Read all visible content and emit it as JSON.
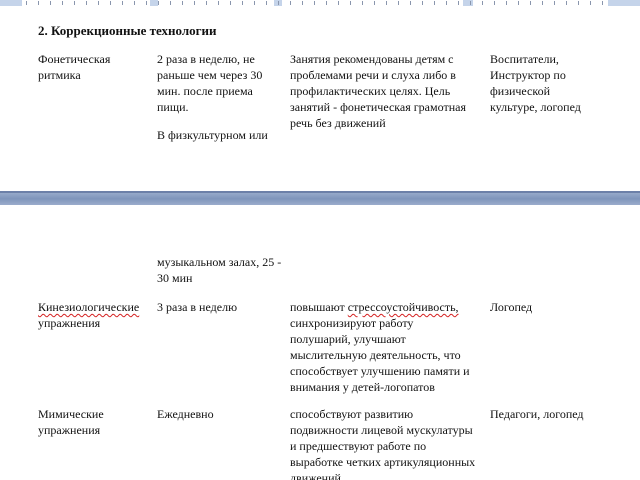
{
  "section": {
    "heading": "2. Коррекционные технологии"
  },
  "rows": [
    {
      "name": "Фонетическая ритмика",
      "frequency_part1": "2 раза в неделю, не раньше чем через 30 мин. после приема пищи.",
      "frequency_part2": "В физкультурном или",
      "description": "Занятия рекомендованы детям с проблемами речи и слуха либо в профилактических целях. Цель занятий - фонетическая грамотная речь без движений",
      "responsible": "Воспитатели, Инструктор по физической культуре, логопед"
    },
    {
      "frequency_continued": "музыкальном залах, 25 - 30 мин"
    },
    {
      "name_word1": "Кинезиологические",
      "name_word2": "упражнения",
      "frequency": "3 раза в неделю",
      "description_word1": "повышают",
      "description_word2": "стрессоустойчивость,",
      "description_rest": "синхронизируют работу полушарий, улучшают мыслительную деятельность, что способствует улучшению памяти и внимания у детей-логопатов",
      "responsible": "Логопед"
    },
    {
      "name": "Мимические упражнения",
      "frequency": "Ежедневно",
      "description": "способствуют развитию подвижности лицевой мускулатуры и предшествуют работе по выработке четких артикуляционных движений.",
      "responsible": "Педагоги, логопед"
    }
  ]
}
